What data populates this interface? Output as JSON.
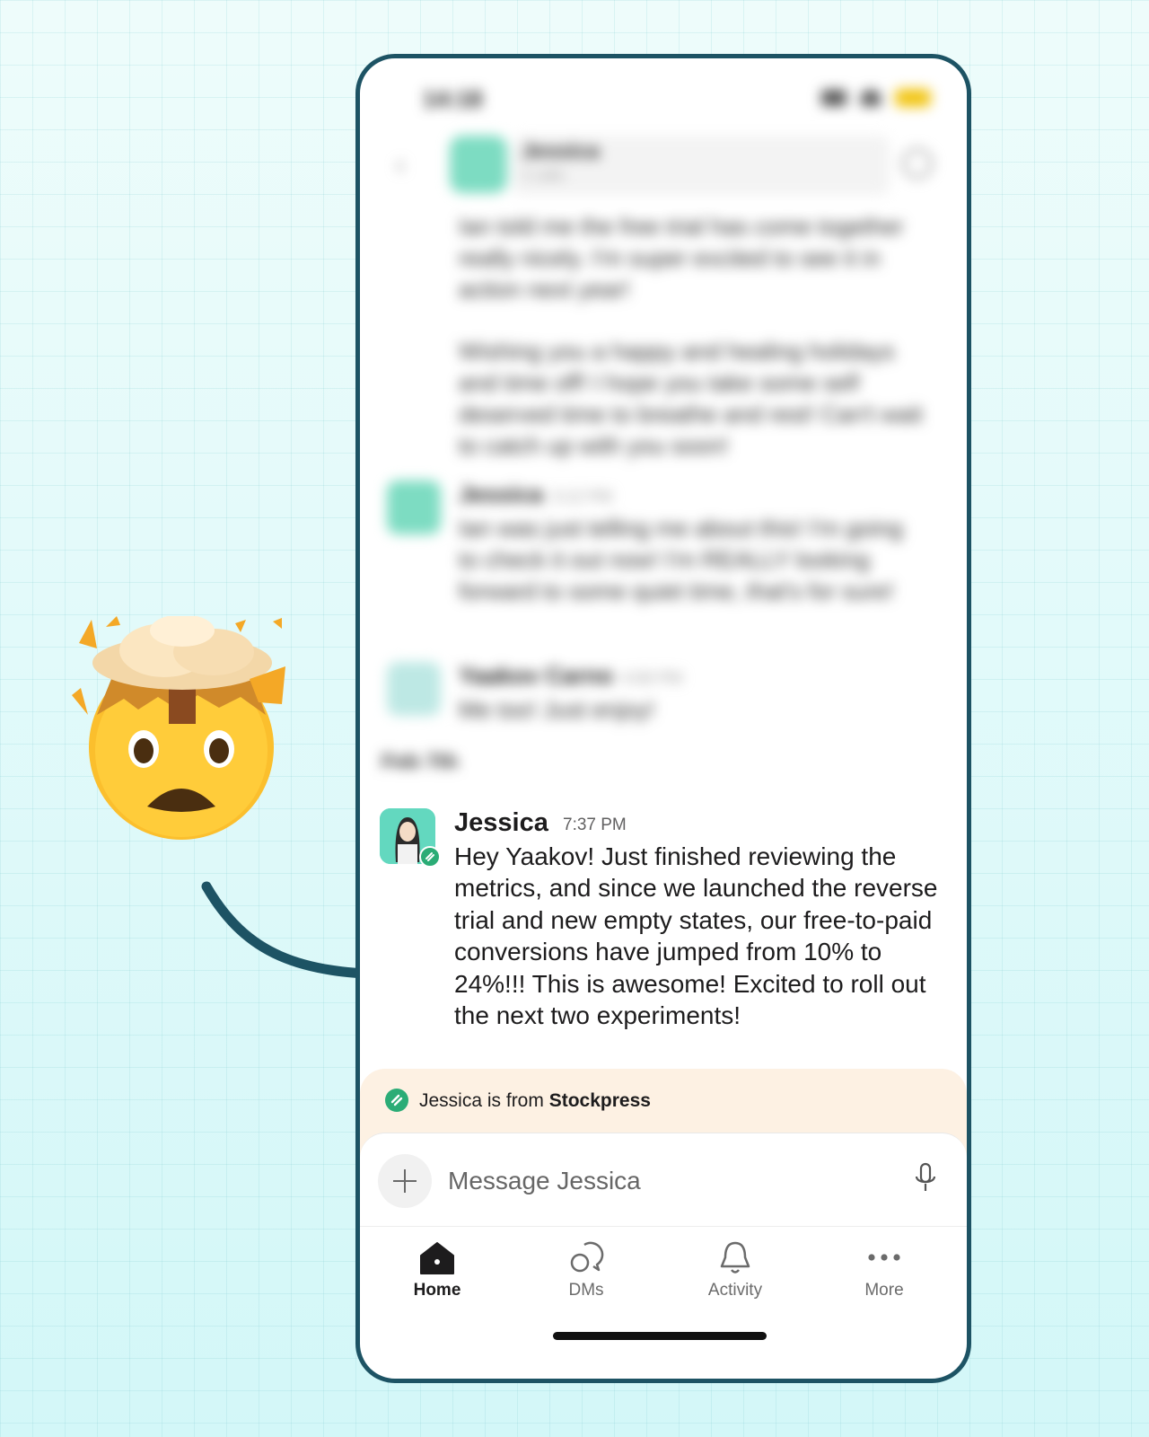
{
  "blurred_background": {
    "status_time": "14:18",
    "header_name": "Jessica",
    "header_subtitle": "1 Labs",
    "messages": [
      "Ian told me the free trial has come together really nicely. I'm super excited to see it in action next year!",
      "Wishing you a happy and healing holidays and time off! I hope you take some self deserved time to breathe and rest! Can't wait to catch up with you soon!"
    ],
    "entries": [
      {
        "name": "Jessica",
        "time": "3:12 PM",
        "text": "Ian was just telling me about this! I'm going to check it out now! I'm REALLY looking forward to some quiet time, that's for sure!"
      },
      {
        "name": "Yaakov Carno",
        "time": "4:00 PM",
        "text": "Me too! Just enjoy!"
      }
    ],
    "date_divider": "Feb 7th"
  },
  "message": {
    "sender": "Jessica",
    "time": "7:37 PM",
    "text": "Hey Yaakov! Just finished reviewing the metrics, and since we launched the reverse trial and new empty states, our free-to-paid conversions have jumped from 10% to 24%!!! This is awesome! Excited to roll out the next two experiments!"
  },
  "external_banner": {
    "prefix": "Jessica is from",
    "org": "Stockpress"
  },
  "composer": {
    "placeholder": "Message Jessica"
  },
  "tabs": [
    {
      "label": "Home",
      "icon": "home-icon",
      "active": true
    },
    {
      "label": "DMs",
      "icon": "dms-icon",
      "active": false
    },
    {
      "label": "Activity",
      "icon": "bell-icon",
      "active": false
    },
    {
      "label": "More",
      "icon": "more-icon",
      "active": false
    }
  ],
  "colors": {
    "frame_border": "#1d5364",
    "banner_bg": "#fdf1e3",
    "external_badge": "#2bac76",
    "background": "#dffaf8"
  }
}
